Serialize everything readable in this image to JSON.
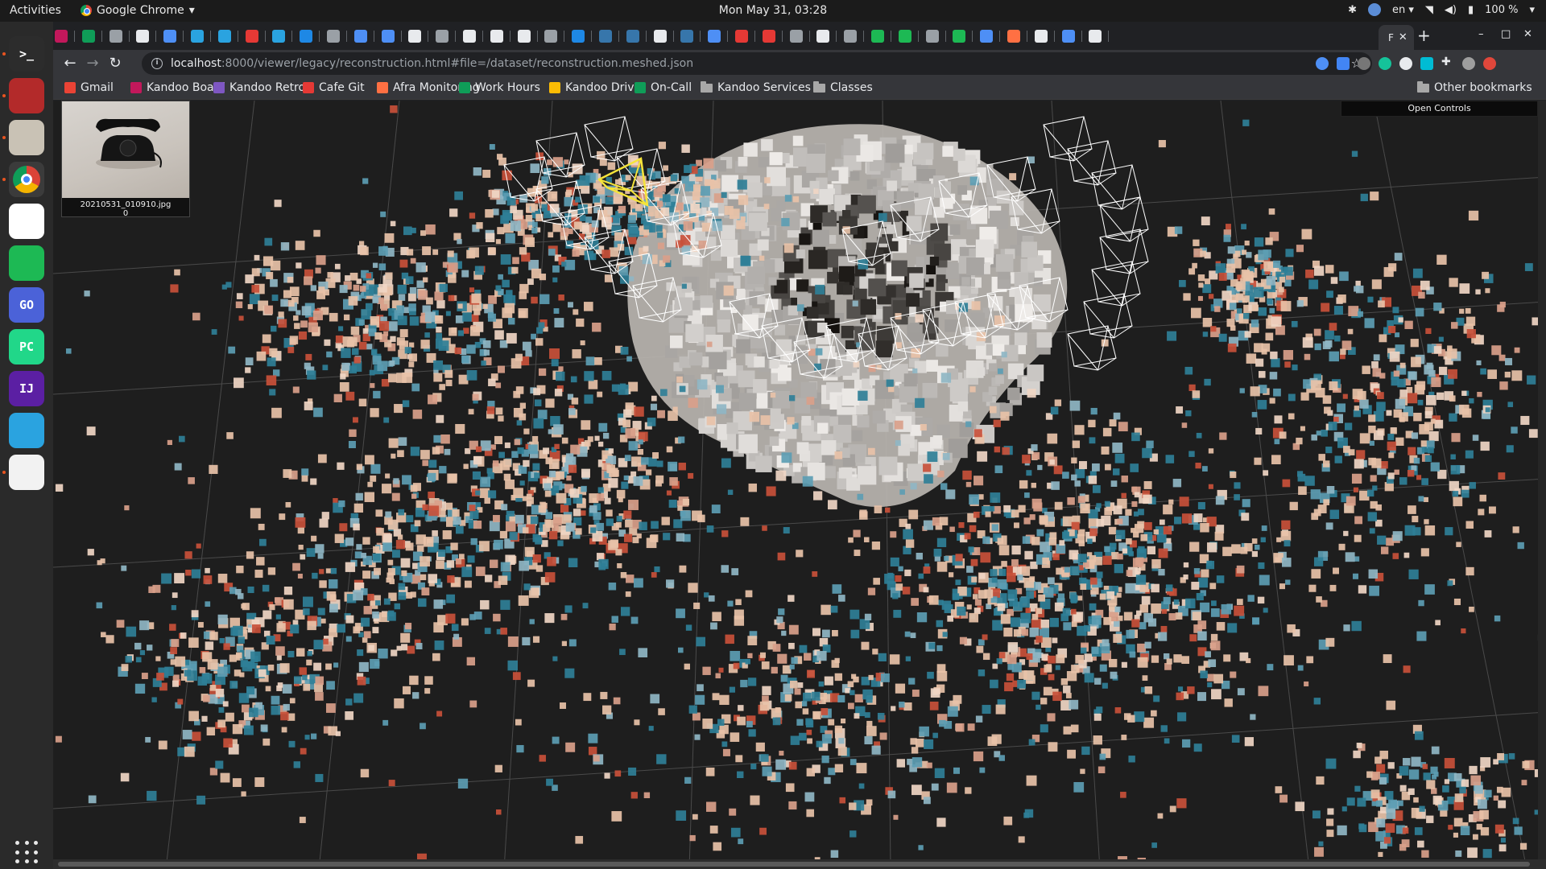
{
  "topbar": {
    "activities": "Activities",
    "app_name": "Google Chrome",
    "clock": "Mon May 31, 03:28",
    "lang": "en",
    "battery": "100 %"
  },
  "dock": {
    "apps": [
      {
        "name": "terminal",
        "glyph": ">_",
        "color": "#2c2c2c"
      },
      {
        "name": "screenshot-tool",
        "glyph": "",
        "color": "#b32a2a"
      },
      {
        "name": "files",
        "glyph": "",
        "color": "#c9c2b5"
      },
      {
        "name": "google-chrome",
        "glyph": "",
        "color": "#3b3b3b"
      },
      {
        "name": "slack",
        "glyph": "",
        "color": "#ffffff"
      },
      {
        "name": "spotify",
        "glyph": "",
        "color": "#1db954"
      },
      {
        "name": "goland",
        "glyph": "GO",
        "color": "#4b62d8"
      },
      {
        "name": "pycharm",
        "glyph": "PC",
        "color": "#21d789"
      },
      {
        "name": "intellij",
        "glyph": "IJ",
        "color": "#5b1fa3"
      },
      {
        "name": "telegram",
        "glyph": "",
        "color": "#2aa3e0"
      },
      {
        "name": "editor",
        "glyph": "",
        "color": "#f2f2f2"
      }
    ]
  },
  "browser": {
    "active_tab_label": "F",
    "address": {
      "host": "localhost",
      "path": ":8000/viewer/legacy/reconstruction.html#file=/dataset/reconstruction.meshed.json"
    },
    "bookmarks": [
      {
        "label": "Gmail",
        "color": "#ea4335"
      },
      {
        "label": "Kandoo Board",
        "color": "#c2185b"
      },
      {
        "label": "Kandoo Retro",
        "color": "#7e57c2"
      },
      {
        "label": "Cafe Git",
        "color": "#e53935"
      },
      {
        "label": "Afra Monitoring",
        "color": "#ff7043"
      },
      {
        "label": "Work Hours",
        "color": "#0f9d58"
      },
      {
        "label": "Kandoo Drive",
        "color": "#fbbc04"
      },
      {
        "label": "On-Call",
        "color": "#0f9d58"
      },
      {
        "label": "Kandoo Services",
        "color": "#a8a8a8"
      },
      {
        "label": "Classes",
        "color": "#a8a8a8"
      }
    ],
    "other_bookmarks": "Other bookmarks"
  },
  "viewer": {
    "image_filename": "20210531_010910.jpg",
    "image_index": "0",
    "controls_label": "Open Controls",
    "palette": {
      "peach": "#e8c2a8",
      "blue": "#2f7f97",
      "red": "#c8503a",
      "grey": "#c9c6c2",
      "dark": "#2a2a2a",
      "camera": "#ffffff",
      "selected_camera": "#f5e43a"
    }
  }
}
